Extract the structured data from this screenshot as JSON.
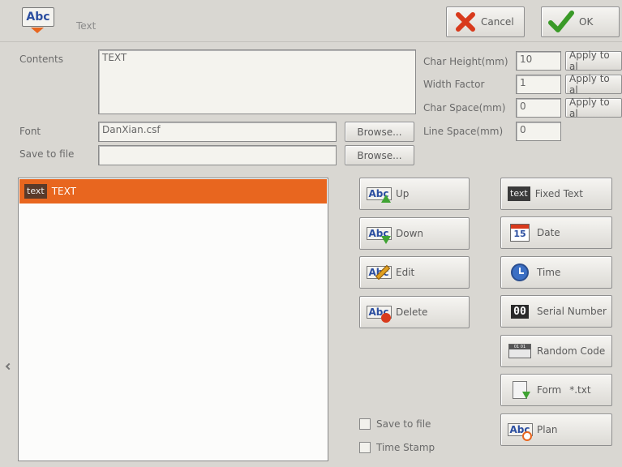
{
  "header": {
    "app_icon_text": "Abc",
    "title": "Text",
    "cancel_label": "Cancel",
    "ok_label": "OK"
  },
  "contents": {
    "label": "Contents",
    "value": "TEXT"
  },
  "params": {
    "char_height": {
      "label": "Char Height(mm)",
      "value": "10",
      "apply_label": "Apply to al"
    },
    "width_factor": {
      "label": "Width Factor",
      "value": "1",
      "apply_label": "Apply to al"
    },
    "char_space": {
      "label": "Char Space(mm)",
      "value": "0",
      "apply_label": "Apply to al"
    },
    "line_space": {
      "label": "Line Space(mm)",
      "value": "0"
    }
  },
  "font": {
    "label": "Font",
    "value": "DanXian.csf",
    "browse_label": "Browse..."
  },
  "save_file": {
    "label": "Save to file",
    "value": "",
    "browse_label": "Browse..."
  },
  "list": {
    "items": [
      {
        "tag": "text",
        "label": "TEXT"
      }
    ]
  },
  "actions": {
    "up": "Up",
    "down": "Down",
    "edit": "Edit",
    "delete": "Delete"
  },
  "icon_labels": {
    "abc": "Abc",
    "text": "text",
    "date_num": "15",
    "serial": "00",
    "random": "01 01"
  },
  "inserts": {
    "fixed_text": "Fixed Text",
    "date": "Date",
    "time": "Time",
    "serial_number": "Serial Number",
    "random_code": "Random Code",
    "form": "Form",
    "form_ext": "*.txt",
    "plan": "Plan"
  },
  "options": {
    "save_to_file": "Save to file",
    "time_stamp": "Time Stamp"
  },
  "colors": {
    "selection": "#e8661f",
    "background": "#d9d7d2",
    "ok_check": "#3a9a28",
    "cancel_x": "#d83a1c"
  }
}
